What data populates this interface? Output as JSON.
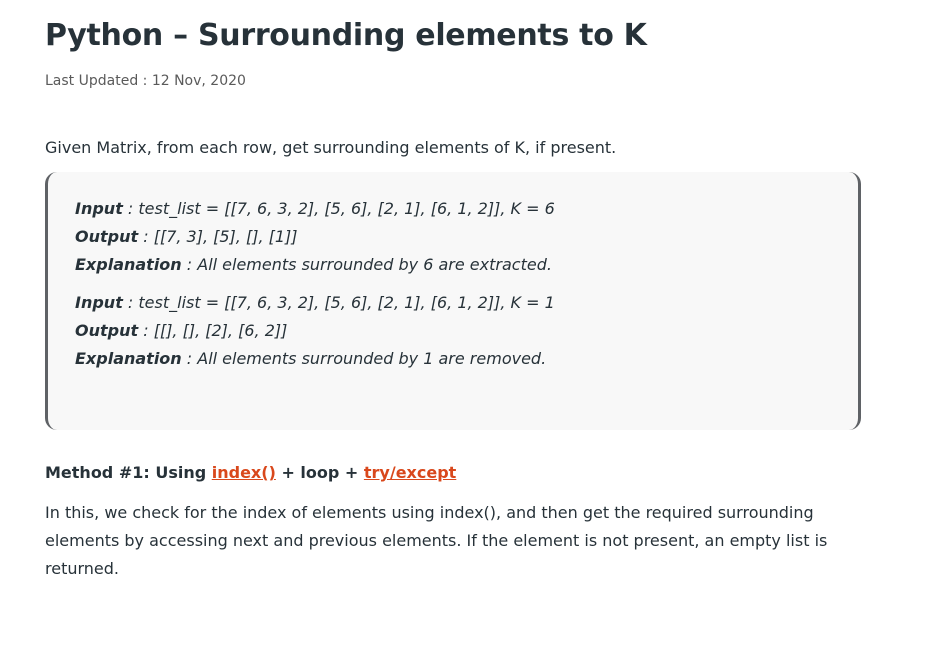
{
  "article": {
    "title": "Python – Surrounding elements to K",
    "last_updated": "Last Updated : 12 Nov, 2020",
    "intro": "Given Matrix, from each row, get surrounding elements of K, if present."
  },
  "examples": [
    {
      "input_label": "Input",
      "input_value": " : test_list = [[7, 6, 3, 2], [5, 6], [2, 1], [6, 1, 2]], K = 6",
      "output_label": "Output",
      "output_value": " : [[7, 3], [5], [], [1]]",
      "explanation_label": "Explanation",
      "explanation_value": " : All elements surrounded by 6 are extracted."
    },
    {
      "input_label": "Input",
      "input_value": " : test_list = [[7, 6, 3, 2], [5, 6], [2, 1], [6, 1, 2]], K = 1",
      "output_label": "Output",
      "output_value": " : [[], [], [2], [6, 2]]",
      "explanation_label": "Explanation",
      "explanation_value": " : All elements surrounded by 1 are removed."
    }
  ],
  "method": {
    "prefix": "Method #1: Using ",
    "link1": "index()",
    "middle": " + loop + ",
    "link2": "try/except"
  },
  "description": "In this, we check for the index of elements using index(), and then get the required surrounding elements by accessing next and previous elements. If the element is not present, an empty list is returned.",
  "colors": {
    "link": "#d9481c",
    "text": "#273239",
    "box_background": "#f8f8f8",
    "box_border": "#5f6266"
  }
}
